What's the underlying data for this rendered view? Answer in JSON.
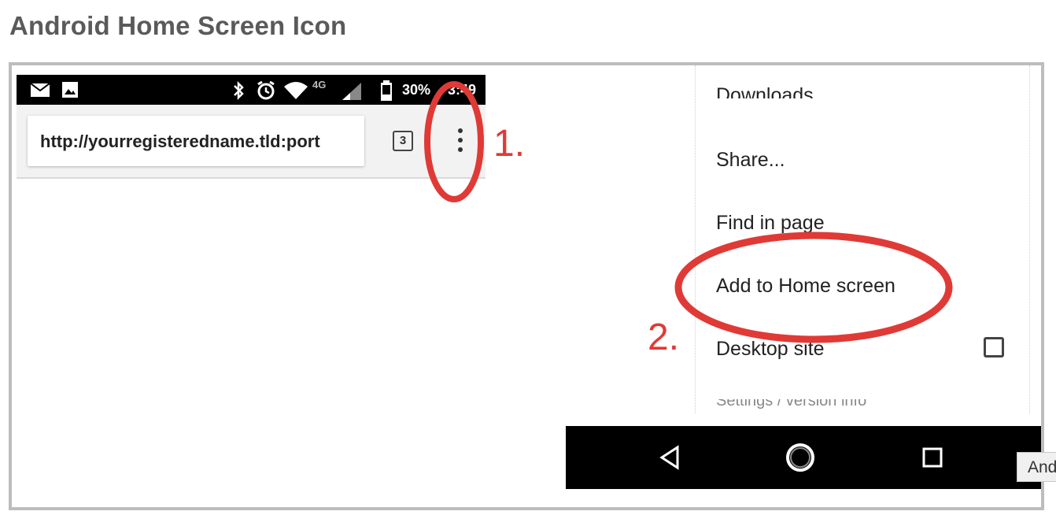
{
  "page": {
    "heading": "Android Home Screen Icon"
  },
  "phone_left": {
    "status_bar": {
      "network_label": "4G",
      "battery": "30%",
      "time": "3:49"
    },
    "toolbar": {
      "url": "http://yourregisteredname.tld:port",
      "tab_count": "3"
    }
  },
  "annotations": {
    "step1": "1.",
    "step2": "2.",
    "highlight_color": "#e03a36"
  },
  "menu": {
    "items": [
      {
        "label": "Downloads"
      },
      {
        "label": "Share..."
      },
      {
        "label": "Find in page"
      },
      {
        "label": "Add to Home screen"
      },
      {
        "label": "Desktop site",
        "checkbox_checked": false
      },
      {
        "label": "Settings / version info"
      }
    ]
  },
  "nav_bar": {
    "buttons": [
      "back-icon",
      "home-icon",
      "recents-icon"
    ]
  },
  "tooltip": {
    "text": "Android Home Screen Icon"
  },
  "icons": [
    "mail-icon",
    "image-icon",
    "bluetooth-icon",
    "alarm-icon",
    "wifi-icon",
    "signal-icon",
    "battery-icon"
  ]
}
